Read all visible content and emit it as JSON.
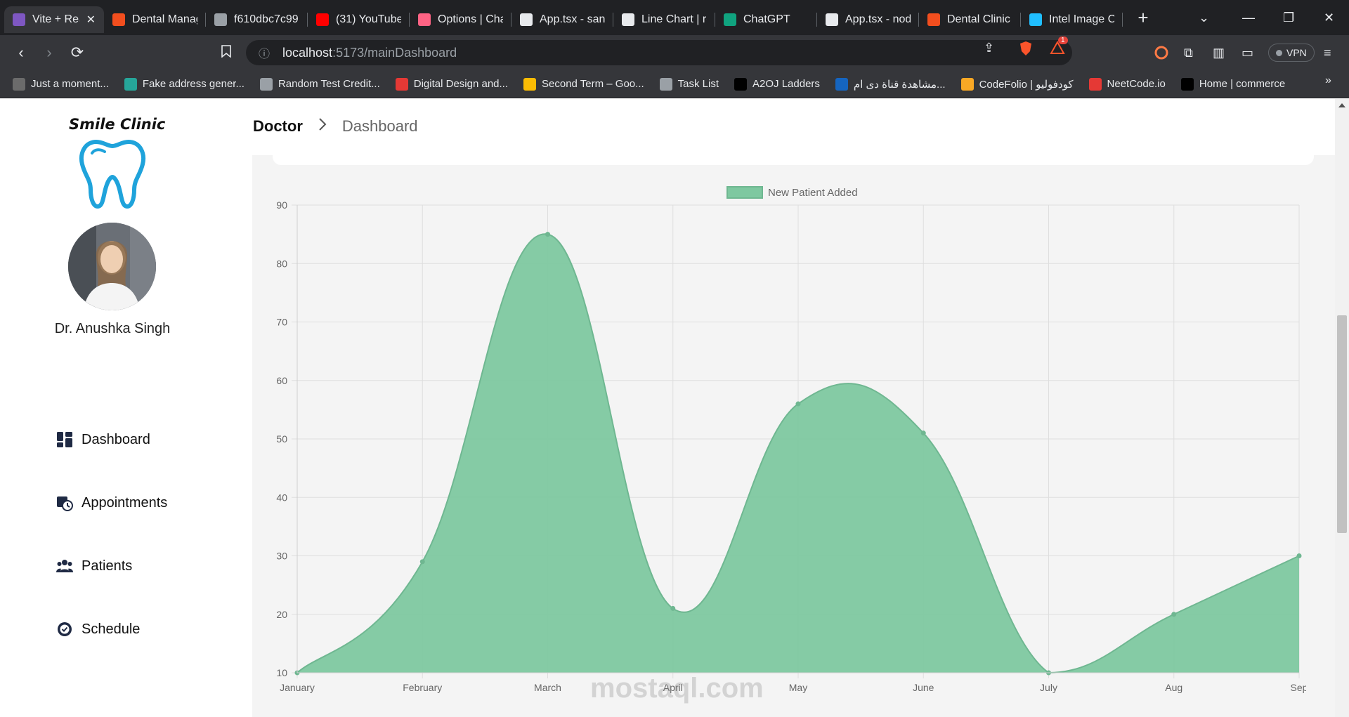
{
  "browser": {
    "tabs": [
      {
        "title": "Vite + React + TS",
        "icon": "vite-icon",
        "color": "#7e57c2",
        "active": true
      },
      {
        "title": "Dental Management",
        "icon": "figma-icon",
        "color": "#f24e1e"
      },
      {
        "title": "f610dbc7c99",
        "icon": "globe-icon",
        "color": "#9aa0a6"
      },
      {
        "title": "(31) YouTube",
        "icon": "youtube-icon",
        "color": "#ff0000"
      },
      {
        "title": "Options | Chart",
        "icon": "chartjs-icon",
        "color": "#ff6384"
      },
      {
        "title": "App.tsx - sandbox",
        "icon": "codesandbox-icon",
        "color": "#e8eaed"
      },
      {
        "title": "Line Chart | react",
        "icon": "layers-icon",
        "color": "#e8eaed"
      },
      {
        "title": "ChatGPT",
        "icon": "chatgpt-icon",
        "color": "#10a37f"
      },
      {
        "title": "App.tsx - node",
        "icon": "codesandbox-icon",
        "color": "#e8eaed"
      },
      {
        "title": "Dental Clinic",
        "icon": "figma-icon",
        "color": "#f24e1e"
      },
      {
        "title": "Intel Image C",
        "icon": "kaggle-icon",
        "color": "#20beff"
      }
    ],
    "url_host": "localhost",
    "url_path": ":5173/mainDashboard",
    "vpn_label": "VPN",
    "brave_badge": "1",
    "bookmarks": [
      {
        "label": "Just a moment...",
        "icon": "cloud-icon",
        "color": "#6b6b6b"
      },
      {
        "label": "Fake address gener...",
        "icon": "xy-icon",
        "color": "#26a69a"
      },
      {
        "label": "Random Test Credit...",
        "icon": "gear-icon",
        "color": "#9aa0a6"
      },
      {
        "label": "Digital Design and...",
        "icon": "pdf-icon",
        "color": "#e53935"
      },
      {
        "label": "Second Term – Goo...",
        "icon": "drive-icon",
        "color": "#fbbc04"
      },
      {
        "label": "Task List",
        "icon": "check-icon",
        "color": "#9aa0a6"
      },
      {
        "label": "A2OJ Ladders",
        "icon": "a2oj-icon",
        "color": "#000000"
      },
      {
        "label": "مشاهدة قناة دى ام...",
        "icon": "tv-icon",
        "color": "#1565c0"
      },
      {
        "label": "CodeFolio | كودفوليو",
        "icon": "codefolio-icon",
        "color": "#f9a825"
      },
      {
        "label": "NeetCode.io",
        "icon": "rocket-icon",
        "color": "#e53935"
      },
      {
        "label": "Home | commerce",
        "icon": "triangle-icon",
        "color": "#000000"
      }
    ]
  },
  "sidebar": {
    "brand": "Smile Clinic",
    "doctor_name": "Dr. Anushka Singh",
    "items": [
      {
        "label": "Dashboard",
        "icon": "dashboard-icon"
      },
      {
        "label": "Appointments",
        "icon": "appointments-icon"
      },
      {
        "label": "Patients",
        "icon": "patients-icon"
      },
      {
        "label": "Schedule",
        "icon": "schedule-icon"
      }
    ]
  },
  "breadcrumb": {
    "root": "Doctor",
    "current": "Dashboard"
  },
  "watermark": "mostaql.com",
  "chart_data": {
    "type": "area",
    "title": "",
    "xlabel": "",
    "ylabel": "",
    "x": [
      "January",
      "February",
      "March",
      "April",
      "May",
      "June",
      "July",
      "Aug",
      "Sep"
    ],
    "series": [
      {
        "name": "New Patient Added",
        "values": [
          10,
          29,
          85,
          21,
          56,
          51,
          10,
          20,
          30
        ],
        "color": "#7ec8a0"
      }
    ],
    "ylim": [
      10,
      90
    ],
    "yticks": [
      10,
      20,
      30,
      40,
      50,
      60,
      70,
      80,
      90
    ],
    "grid": true,
    "legend": "top-center",
    "smooth": true
  }
}
